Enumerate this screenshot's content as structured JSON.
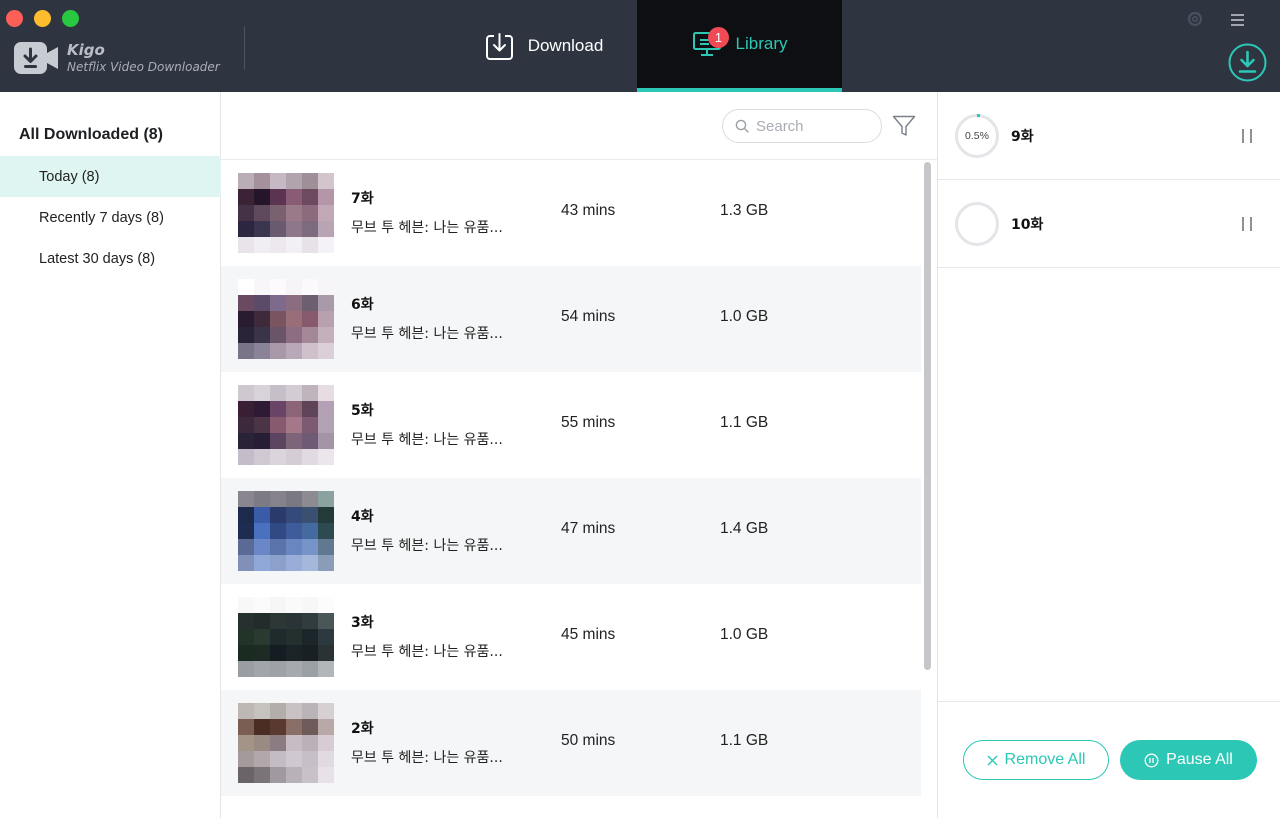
{
  "app": {
    "name": "Kigo",
    "subtitle": "Netflix Video Downloader"
  },
  "nav": {
    "download_label": "Download",
    "library_label": "Library",
    "library_badge": "1",
    "active_tab": "Library",
    "accent_color": "#2dc7b5"
  },
  "sidebar": {
    "heading": "All Downloaded (8)",
    "items": [
      {
        "label": "Today (8)",
        "active": true
      },
      {
        "label": "Recently 7 days (8)",
        "active": false
      },
      {
        "label": "Latest 30 days (8)",
        "active": false
      }
    ]
  },
  "toolbar": {
    "search_placeholder": "Search"
  },
  "rows": [
    {
      "episode": "7화",
      "title": "무브 투 헤븐: 나는 유품...",
      "duration": "43 mins",
      "size": "1.3 GB"
    },
    {
      "episode": "6화",
      "title": "무브 투 헤븐: 나는 유품...",
      "duration": "54 mins",
      "size": "1.0 GB"
    },
    {
      "episode": "5화",
      "title": "무브 투 헤븐: 나는 유품...",
      "duration": "55 mins",
      "size": "1.1 GB"
    },
    {
      "episode": "4화",
      "title": "무브 투 헤븐: 나는 유품...",
      "duration": "47 mins",
      "size": "1.4 GB"
    },
    {
      "episode": "3화",
      "title": "무브 투 헤븐: 나는 유품...",
      "duration": "45 mins",
      "size": "1.0 GB"
    },
    {
      "episode": "2화",
      "title": "무브 투 헤븐: 나는 유품...",
      "duration": "50 mins",
      "size": "1.1 GB"
    }
  ],
  "queue": [
    {
      "name": "9화",
      "progress_text": "0.5%",
      "progress": 0.005
    },
    {
      "name": "10화",
      "progress_text": "",
      "progress": 0
    }
  ],
  "actions": {
    "remove_all": "Remove All",
    "pause_all": "Pause All"
  }
}
